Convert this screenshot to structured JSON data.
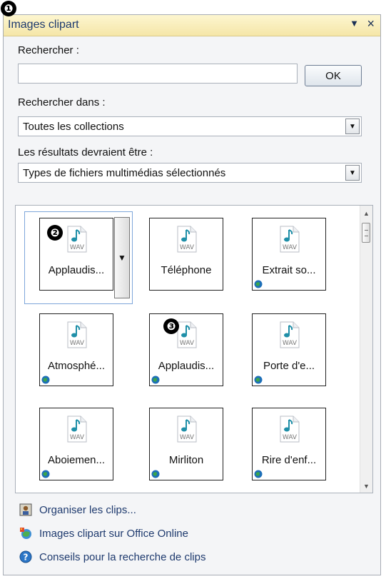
{
  "callouts": [
    "❶",
    "❷",
    "❸"
  ],
  "pane": {
    "title": "Images clipart",
    "menu_arrow": "▼",
    "close": "×"
  },
  "search": {
    "label": "Rechercher :",
    "value": "",
    "ok": "OK"
  },
  "search_in": {
    "label": "Rechercher dans :",
    "value": "Toutes les collections"
  },
  "results_type": {
    "label": "Les résultats devraient être :",
    "value": "Types de fichiers multimédias sélectionnés"
  },
  "clips": [
    {
      "label": "Applaudis...",
      "type": "WAV",
      "globe": false,
      "selected": true
    },
    {
      "label": "Téléphone",
      "type": "WAV",
      "globe": false
    },
    {
      "label": "Extrait so...",
      "type": "WAV",
      "globe": true
    },
    {
      "label": "Atmosphé...",
      "type": "WAV",
      "globe": true
    },
    {
      "label": "Applaudis...",
      "type": "WAV",
      "globe": true
    },
    {
      "label": "Porte d'e...",
      "type": "WAV",
      "globe": true
    },
    {
      "label": "Aboiemen...",
      "type": "WAV",
      "globe": true
    },
    {
      "label": "Mirliton",
      "type": "WAV",
      "globe": true
    },
    {
      "label": "Rire d'enf...",
      "type": "WAV",
      "globe": true
    }
  ],
  "footer": {
    "organize": "Organiser les clips...",
    "online": "Images clipart sur Office Online",
    "tips": "Conseils pour la recherche de clips"
  }
}
